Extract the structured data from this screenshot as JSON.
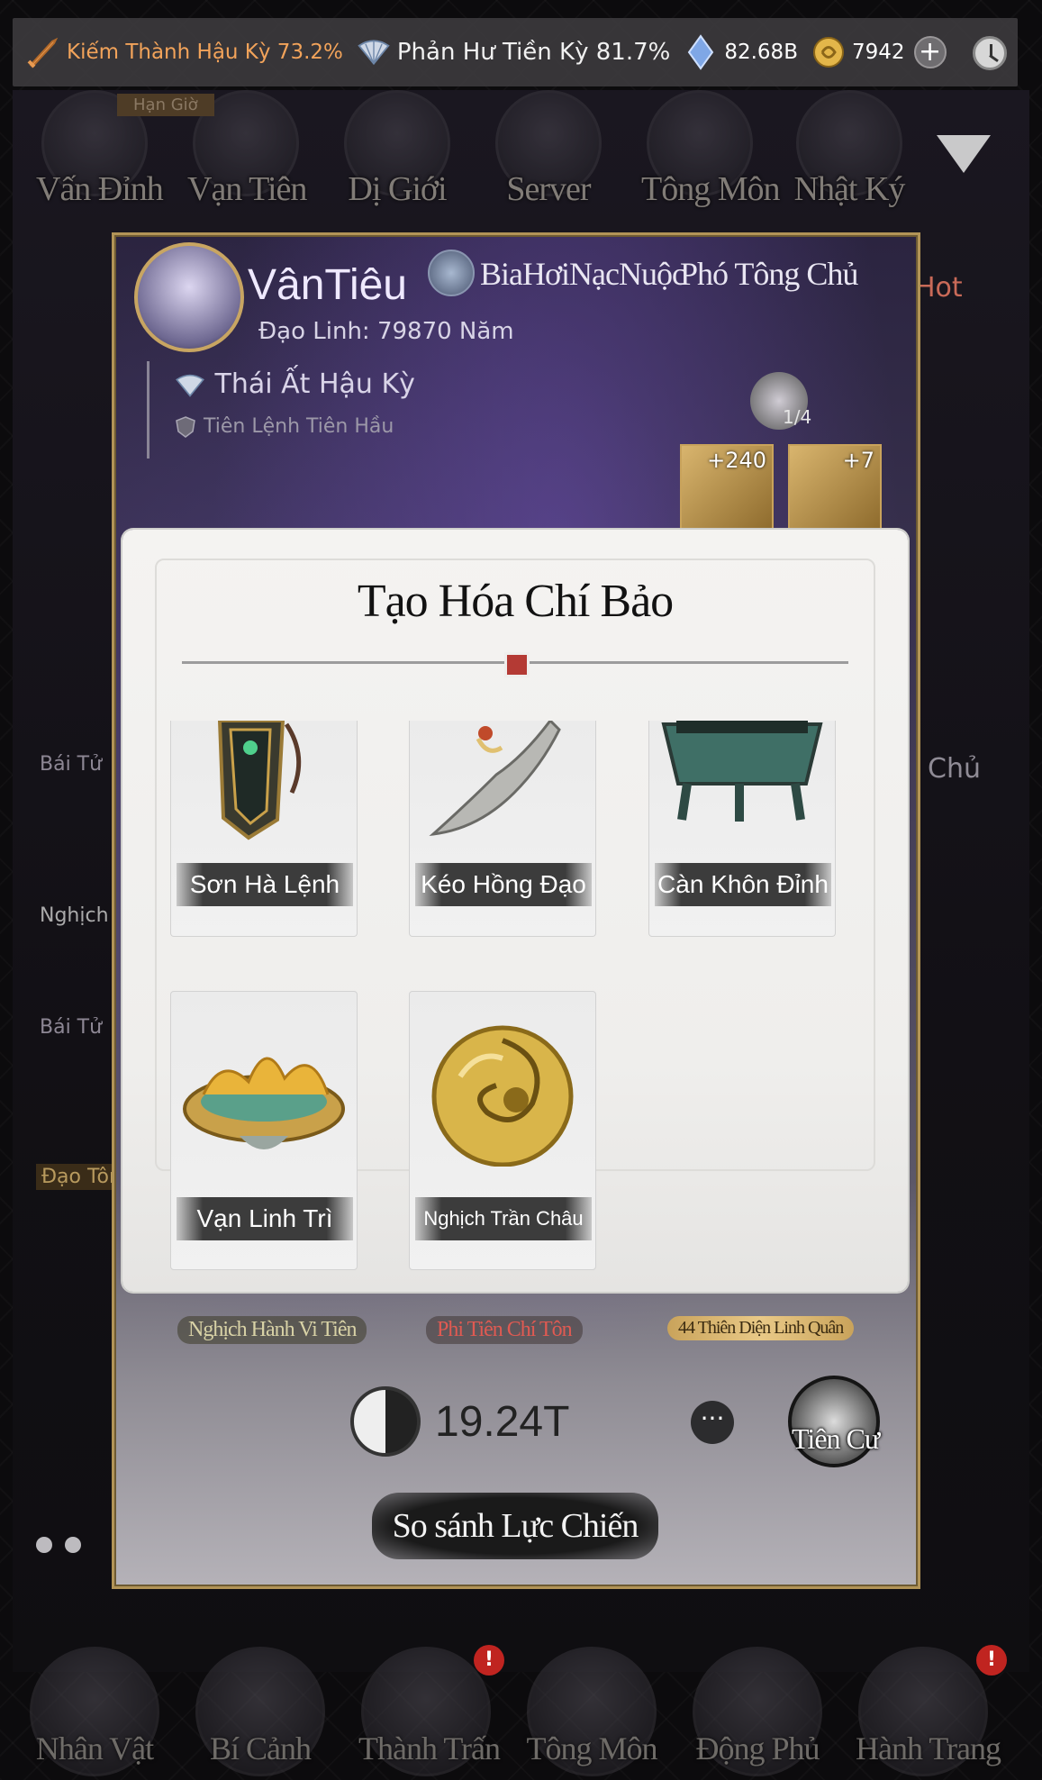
{
  "topbar": {
    "realm1": "Kiếm Thành Hậu Kỳ 73.2%",
    "realm2": "Phản Hư Tiền Kỳ 81.7%",
    "crystal": "82.68B",
    "coin": "7942",
    "plus": "+"
  },
  "topnav": {
    "badge": "Hạn Giờ",
    "items": [
      "Vấn Đỉnh",
      "Vạn Tiên",
      "Dị Giới",
      "Server",
      "Tông Môn",
      "Nhật Ký"
    ]
  },
  "card": {
    "player_name": "VânTiêu",
    "guild": "BiaHơiNạcNuộc",
    "role": "Phó Tông Chủ",
    "aura": "Đạo Linh: 79870 Năm",
    "realm": "Thái Ất Hậu Kỳ",
    "title": "Tiên Lệnh Tiên Hầu",
    "count": "1/4",
    "item1": "+240",
    "item2": "+7",
    "tags": [
      "Nghịch Hành Vi Tiên",
      "Phi Tiên Chí Tôn",
      "44 Thiên Diện Linh Quân"
    ],
    "power": "19.24T",
    "more": "···",
    "tiencu": "Tiên Cư",
    "compare_button": "So sánh Lực Chiến"
  },
  "side": {
    "hot": "Hot",
    "chu": "Chủ",
    "bai_tu_1": "Bái Tử",
    "bai_tu_2": "Bái Tử",
    "dao_ton": "Đạo Tôn L",
    "nghich": "Nghịch H"
  },
  "dialog": {
    "title": "Tạo Hóa Chí Bảo",
    "items": [
      {
        "name": "Sơn Hà Lệnh"
      },
      {
        "name": "Kéo Hồng Đạo"
      },
      {
        "name": "Càn Khôn Đỉnh"
      },
      {
        "name": "Vạn Linh Trì"
      },
      {
        "name": "Nghịch Trần Châu"
      }
    ]
  },
  "bottomnav": {
    "items": [
      "Nhân Vật",
      "Bí Cảnh",
      "Thành Trấn",
      "Tông Môn",
      "Động Phủ",
      "Hành Trang"
    ],
    "badge": "!"
  }
}
